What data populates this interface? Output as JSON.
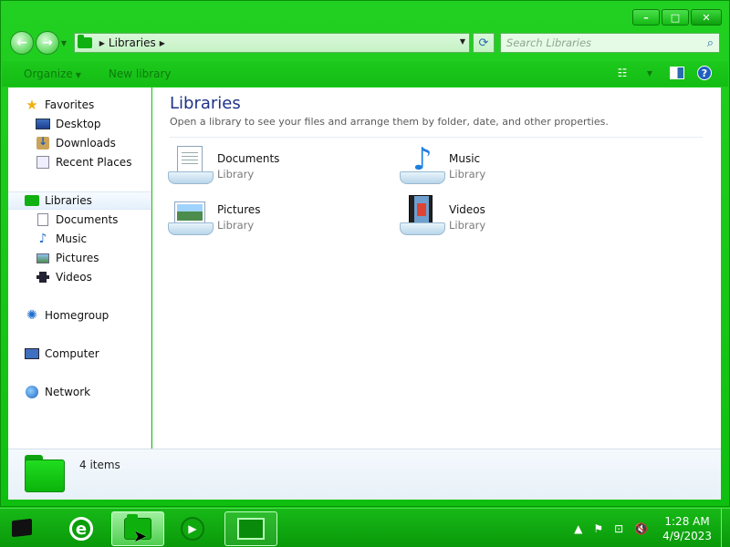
{
  "window": {
    "controls": {
      "minimize": "–",
      "maximize": "□",
      "close": "✕"
    }
  },
  "address_bar": {
    "path": [
      "Libraries"
    ],
    "search_placeholder": "Search Libraries"
  },
  "toolbar": {
    "organize_label": "Organize",
    "new_library_label": "New library"
  },
  "nav_pane": {
    "favorites": {
      "label": "Favorites",
      "items": [
        "Desktop",
        "Downloads",
        "Recent Places"
      ]
    },
    "libraries": {
      "label": "Libraries",
      "items": [
        "Documents",
        "Music",
        "Pictures",
        "Videos"
      ]
    },
    "homegroup": "Homegroup",
    "computer": "Computer",
    "network": "Network"
  },
  "content": {
    "title": "Libraries",
    "subtitle": "Open a library to see your files and arrange them by folder, date, and other properties.",
    "items": [
      {
        "name": "Documents",
        "type": "Library"
      },
      {
        "name": "Music",
        "type": "Library"
      },
      {
        "name": "Pictures",
        "type": "Library"
      },
      {
        "name": "Videos",
        "type": "Library"
      }
    ]
  },
  "details": {
    "count_text": "4 items"
  },
  "taskbar": {
    "clock_time": "1:28 AM",
    "clock_date": "4/9/2023"
  }
}
